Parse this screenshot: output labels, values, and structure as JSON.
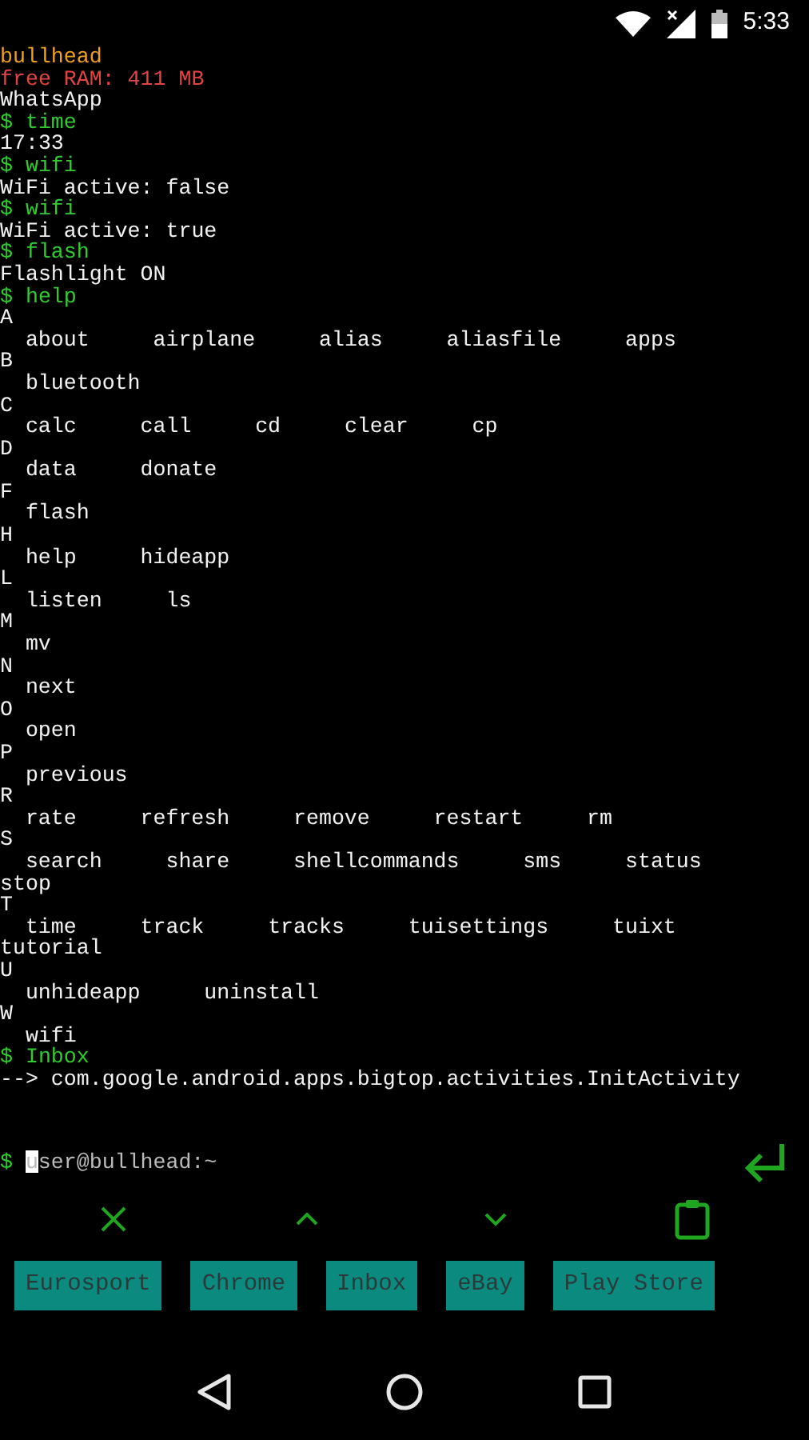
{
  "status_bar": {
    "time": "5:33"
  },
  "terminal": [
    {
      "kind": "host",
      "text": "bullhead"
    },
    {
      "kind": "ram",
      "text": "free RAM: 411 MB"
    },
    {
      "kind": "output",
      "text": "WhatsApp"
    },
    {
      "kind": "command",
      "text": "$ time"
    },
    {
      "kind": "output",
      "text": "17:33"
    },
    {
      "kind": "command",
      "text": "$ wifi"
    },
    {
      "kind": "output",
      "text": "WiFi active: false"
    },
    {
      "kind": "command",
      "text": "$ wifi"
    },
    {
      "kind": "output",
      "text": "WiFi active: true"
    },
    {
      "kind": "command",
      "text": "$ flash"
    },
    {
      "kind": "output",
      "text": "Flashlight ON"
    },
    {
      "kind": "command",
      "text": "$ help"
    },
    {
      "kind": "help_group",
      "letter": "A",
      "commands": [
        "about",
        "airplane",
        "alias",
        "aliasfile",
        "apps"
      ]
    },
    {
      "kind": "help_group",
      "letter": "B",
      "commands": [
        "bluetooth"
      ]
    },
    {
      "kind": "help_group",
      "letter": "C",
      "commands": [
        "calc",
        "call",
        "cd",
        "clear",
        "cp"
      ]
    },
    {
      "kind": "help_group",
      "letter": "D",
      "commands": [
        "data",
        "donate"
      ]
    },
    {
      "kind": "help_group",
      "letter": "F",
      "commands": [
        "flash"
      ]
    },
    {
      "kind": "help_group",
      "letter": "H",
      "commands": [
        "help",
        "hideapp"
      ]
    },
    {
      "kind": "help_group",
      "letter": "L",
      "commands": [
        "listen",
        "ls"
      ]
    },
    {
      "kind": "help_group",
      "letter": "M",
      "commands": [
        "mv"
      ]
    },
    {
      "kind": "help_group",
      "letter": "N",
      "commands": [
        "next"
      ]
    },
    {
      "kind": "help_group",
      "letter": "O",
      "commands": [
        "open"
      ]
    },
    {
      "kind": "help_group",
      "letter": "P",
      "commands": [
        "previous"
      ]
    },
    {
      "kind": "help_group",
      "letter": "R",
      "commands": [
        "rate",
        "refresh",
        "remove",
        "restart",
        "rm"
      ]
    },
    {
      "kind": "help_group",
      "letter": "S",
      "commands": [
        "search",
        "share",
        "shellcommands",
        "sms",
        "status"
      ],
      "overflow": [
        "stop"
      ]
    },
    {
      "kind": "help_group",
      "letter": "T",
      "commands": [
        "time",
        "track",
        "tracks",
        "tuisettings",
        "tuixt"
      ],
      "overflow": [
        "tutorial"
      ]
    },
    {
      "kind": "help_group",
      "letter": "U",
      "commands": [
        "unhideapp",
        "uninstall"
      ]
    },
    {
      "kind": "help_group",
      "letter": "W",
      "commands": [
        "wifi"
      ]
    },
    {
      "kind": "command",
      "text": "$ Inbox"
    },
    {
      "kind": "output",
      "text": "--> com.google.android.apps.bigtop.activities.InitActivity"
    }
  ],
  "input": {
    "prompt": "$",
    "placeholder": "user@bullhead:~"
  },
  "apps": [
    "Eurosport",
    "Chrome",
    "Inbox",
    "eBay",
    "Play Store"
  ]
}
